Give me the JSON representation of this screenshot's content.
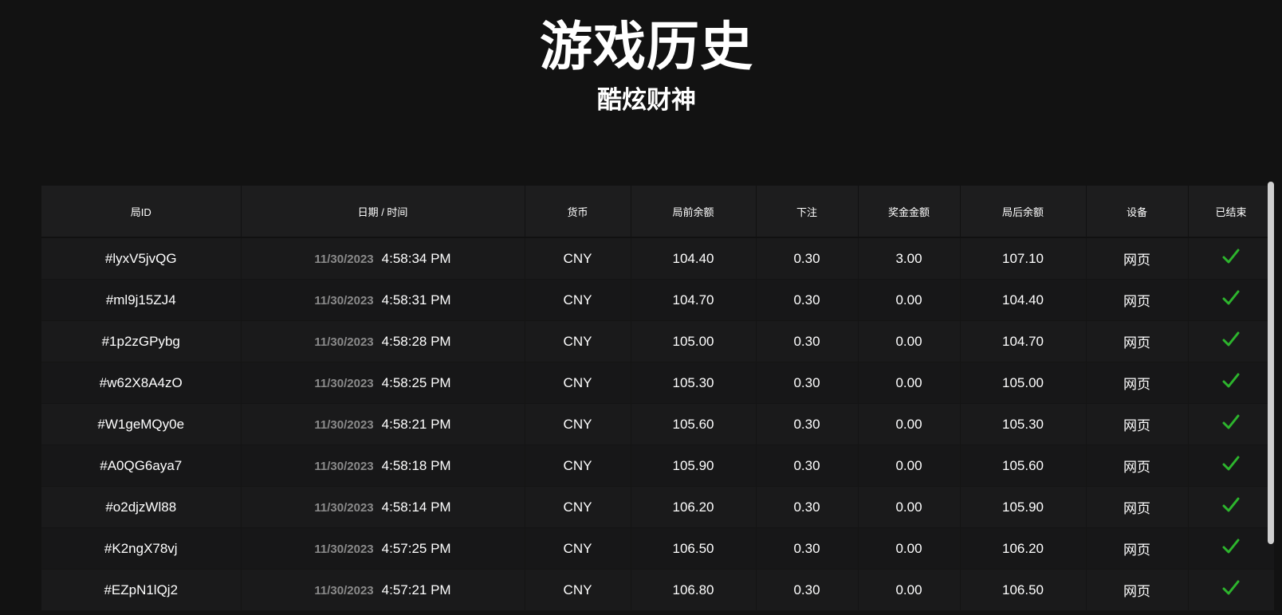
{
  "header": {
    "title": "游戏历史",
    "subtitle": "酷炫财神"
  },
  "table": {
    "columns": [
      "局ID",
      "日期 / 时间",
      "货币",
      "局前余额",
      "下注",
      "奖金金额",
      "局后余额",
      "设备",
      "已结束"
    ],
    "rows": [
      {
        "id": "#lyxV5jvQG",
        "date": "11/30/2023",
        "time": "4:58:34 PM",
        "currency": "CNY",
        "balance_before": "104.40",
        "bet": "0.30",
        "win": "3.00",
        "balance_after": "107.10",
        "device": "网页",
        "finished": "check-icon"
      },
      {
        "id": "#ml9j15ZJ4",
        "date": "11/30/2023",
        "time": "4:58:31 PM",
        "currency": "CNY",
        "balance_before": "104.70",
        "bet": "0.30",
        "win": "0.00",
        "balance_after": "104.40",
        "device": "网页",
        "finished": "check-icon"
      },
      {
        "id": "#1p2zGPybg",
        "date": "11/30/2023",
        "time": "4:58:28 PM",
        "currency": "CNY",
        "balance_before": "105.00",
        "bet": "0.30",
        "win": "0.00",
        "balance_after": "104.70",
        "device": "网页",
        "finished": "check-icon"
      },
      {
        "id": "#w62X8A4zO",
        "date": "11/30/2023",
        "time": "4:58:25 PM",
        "currency": "CNY",
        "balance_before": "105.30",
        "bet": "0.30",
        "win": "0.00",
        "balance_after": "105.00",
        "device": "网页",
        "finished": "check-icon"
      },
      {
        "id": "#W1geMQy0e",
        "date": "11/30/2023",
        "time": "4:58:21 PM",
        "currency": "CNY",
        "balance_before": "105.60",
        "bet": "0.30",
        "win": "0.00",
        "balance_after": "105.30",
        "device": "网页",
        "finished": "check-icon"
      },
      {
        "id": "#A0QG6aya7",
        "date": "11/30/2023",
        "time": "4:58:18 PM",
        "currency": "CNY",
        "balance_before": "105.90",
        "bet": "0.30",
        "win": "0.00",
        "balance_after": "105.60",
        "device": "网页",
        "finished": "check-icon"
      },
      {
        "id": "#o2djzWl88",
        "date": "11/30/2023",
        "time": "4:58:14 PM",
        "currency": "CNY",
        "balance_before": "106.20",
        "bet": "0.30",
        "win": "0.00",
        "balance_after": "105.90",
        "device": "网页",
        "finished": "check-icon"
      },
      {
        "id": "#K2ngX78vj",
        "date": "11/30/2023",
        "time": "4:57:25 PM",
        "currency": "CNY",
        "balance_before": "106.50",
        "bet": "0.30",
        "win": "0.00",
        "balance_after": "106.20",
        "device": "网页",
        "finished": "check-icon"
      },
      {
        "id": "#EZpN1lQj2",
        "date": "11/30/2023",
        "time": "4:57:21 PM",
        "currency": "CNY",
        "balance_before": "106.80",
        "bet": "0.30",
        "win": "0.00",
        "balance_after": "106.50",
        "device": "网页",
        "finished": "check-icon"
      }
    ]
  },
  "colors": {
    "background": "#121212",
    "header_row": "#1d1d1e",
    "check": "#2db52d",
    "date_text": "#8a8a8a"
  }
}
